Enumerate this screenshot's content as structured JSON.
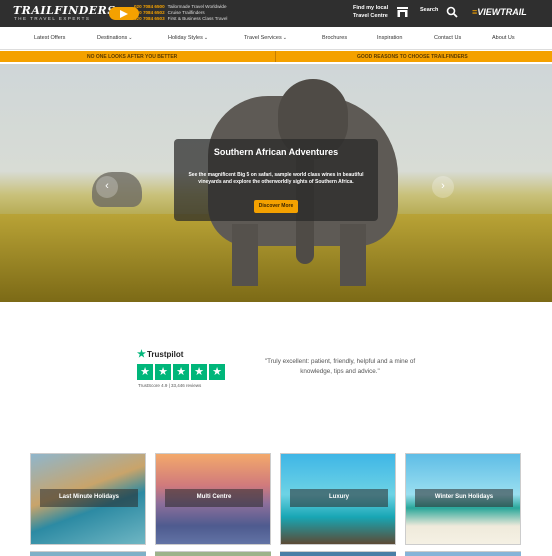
{
  "brand": {
    "logo_text": "TRAILFINDERS",
    "tagline": "THE TRAVEL EXPERTS"
  },
  "phones": [
    {
      "number": "020 7084 6500",
      "label": "Tailormade Travel Worldwide"
    },
    {
      "number": "020 7084 6502",
      "label": "Cruise Trailfinders"
    },
    {
      "number": "020 7084 6503",
      "label": "First & Business Class Travel"
    }
  ],
  "header": {
    "find_centre_line1": "Find my local",
    "find_centre_line2": "Travel Centre",
    "search_label": "Search",
    "viewtrail_prefix": "≡",
    "viewtrail_label": "VIEWTRAIL"
  },
  "nav": {
    "items": [
      {
        "label": "Latest Offers",
        "has_dropdown": false
      },
      {
        "label": "Destinations",
        "has_dropdown": true
      },
      {
        "label": "Holiday Styles",
        "has_dropdown": true
      },
      {
        "label": "Travel Services",
        "has_dropdown": true
      },
      {
        "label": "Brochures",
        "has_dropdown": false
      },
      {
        "label": "Inspiration",
        "has_dropdown": false
      },
      {
        "label": "Contact Us",
        "has_dropdown": false
      },
      {
        "label": "About Us",
        "has_dropdown": false
      }
    ],
    "caret": "⌄"
  },
  "strip": {
    "left": "No one looks after you better",
    "right": "Good reasons to choose Trailfinders"
  },
  "hero": {
    "title": "Southern African Adventures",
    "text": "See the magnificent Big 5 on safari, sample world class wines in beautiful vineyards and explore the otherworldly sights of Southern Africa.",
    "button": "Discover More",
    "prev": "‹",
    "next": "›"
  },
  "trustpilot": {
    "logo": "Trustpilot",
    "star_glyph": "★",
    "rating": 5,
    "score_text": "TrustScore 4.9 | 33,446 reviews",
    "quote": "\"Truly excellent: patient, friendly, helpful and a mine of knowledge, tips and advice.\""
  },
  "tiles": [
    {
      "label": "Last Minute Holidays"
    },
    {
      "label": "Multi Centre"
    },
    {
      "label": "Luxury"
    },
    {
      "label": "Winter Sun Holidays"
    }
  ],
  "colors": {
    "accent": "#f4a100",
    "topbar": "#2f2f2f",
    "trustpilot_green": "#00b67a"
  }
}
